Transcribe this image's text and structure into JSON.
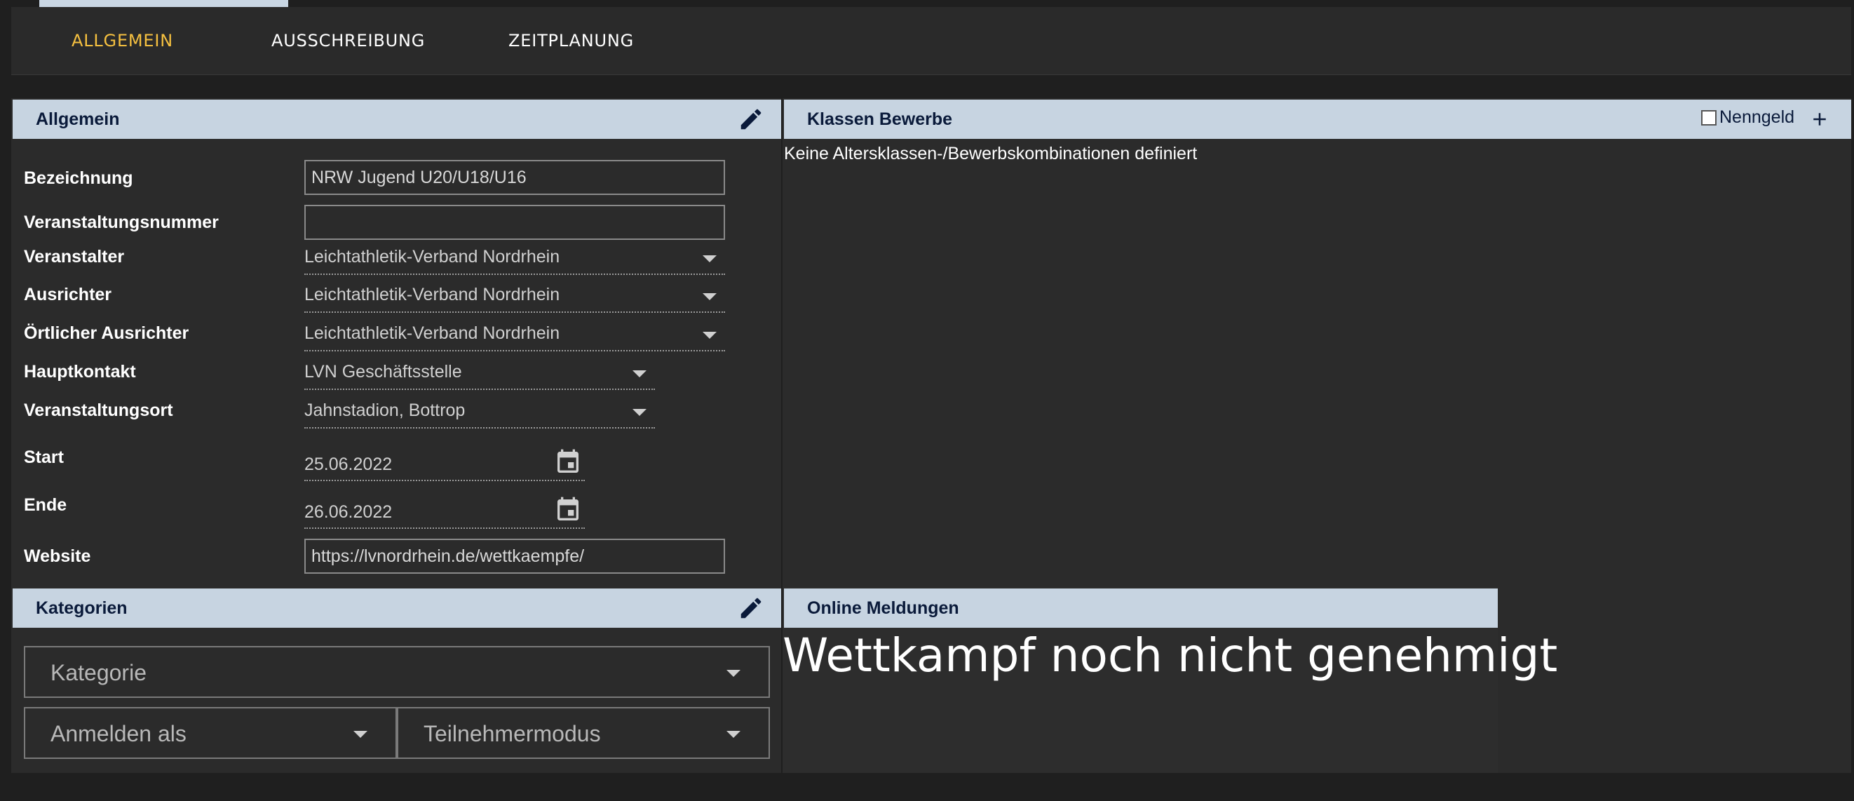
{
  "tabs": [
    {
      "label": "ALLGEMEIN",
      "active": true
    },
    {
      "label": "AUSSCHREIBUNG",
      "active": false
    },
    {
      "label": "ZEITPLANUNG",
      "active": false
    }
  ],
  "allgemein": {
    "title": "Allgemein",
    "edit_icon": "pencil-icon",
    "fields": {
      "bezeichnung": {
        "label": "Bezeichnung",
        "value": "NRW Jugend U20/U18/U16"
      },
      "veranstaltungsnummer": {
        "label": "Veranstaltungsnummer",
        "value": ""
      },
      "veranstalter": {
        "label": "Veranstalter",
        "value": "Leichtathletik-Verband Nordrhein"
      },
      "ausrichter": {
        "label": "Ausrichter",
        "value": "Leichtathletik-Verband Nordrhein"
      },
      "oertlicher_ausrichter": {
        "label": "Örtlicher Ausrichter",
        "value": "Leichtathletik-Verband Nordrhein"
      },
      "hauptkontakt": {
        "label": "Hauptkontakt",
        "value": "LVN Geschäftsstelle"
      },
      "veranstaltungsort": {
        "label": "Veranstaltungsort",
        "value": "Jahnstadion, Bottrop"
      },
      "start": {
        "label": "Start",
        "value": "25.06.2022"
      },
      "ende": {
        "label": "Ende",
        "value": "26.06.2022"
      },
      "website": {
        "label": "Website",
        "value": "https://lvnordrhein.de/wettkaempfe/"
      }
    }
  },
  "klassen": {
    "title": "Klassen Bewerbe",
    "nenngeld_label": "Nenngeld",
    "nenngeld_checked": false,
    "empty_text": "Keine Altersklassen-/Bewerbskombinationen definiert"
  },
  "kategorien": {
    "title": "Kategorien",
    "kategorie_placeholder": "Kategorie",
    "anmelden_placeholder": "Anmelden als",
    "teilnehmer_placeholder": "Teilnehmermodus"
  },
  "online": {
    "title": "Online Meldungen",
    "status_text": "Wettkampf noch nicht genehmigt"
  },
  "colors": {
    "accent": "#f5c040",
    "header_bg": "#c7d4e1",
    "header_text": "#0a1a3a",
    "panel_bg": "#2b2b2b",
    "page_bg": "#1f1f1f"
  }
}
